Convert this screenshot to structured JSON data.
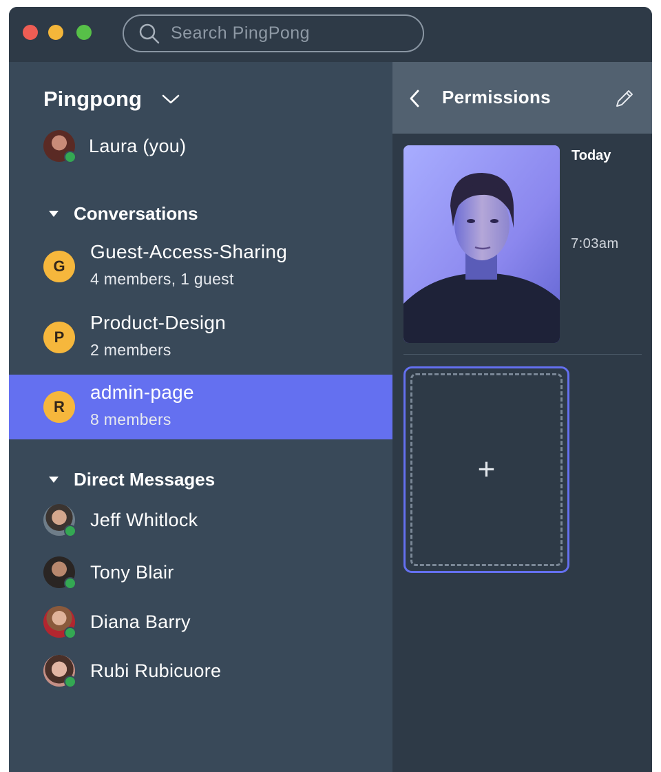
{
  "window": {
    "controls": [
      "close",
      "minimize",
      "zoom"
    ]
  },
  "search": {
    "placeholder": "Search PingPong",
    "icon": "search-icon"
  },
  "sidebar": {
    "team_name": "Pingpong",
    "current_user": {
      "name": "Laura (you)",
      "status": "online"
    },
    "conversations_header": "Conversations",
    "conversations": [
      {
        "letter": "G",
        "name": "Guest-Access-Sharing",
        "subtitle": "4 members, 1 guest",
        "active": false
      },
      {
        "letter": "P",
        "name": "Product-Design",
        "subtitle": "2 members",
        "active": false
      },
      {
        "letter": "R",
        "name": "admin-page",
        "subtitle": "8 members",
        "active": true
      }
    ],
    "dm_header": "Direct Messages",
    "direct_messages": [
      {
        "name": "Jeff Whitlock",
        "status": "online"
      },
      {
        "name": "Tony Blair",
        "status": "online"
      },
      {
        "name": "Diana Barry",
        "status": "online"
      },
      {
        "name": "Rubi Rubicuore",
        "status": "online"
      }
    ]
  },
  "panel": {
    "title": "Permissions",
    "date_label": "Today",
    "time_label": "7:03am",
    "upload_symbol": "+"
  },
  "colors": {
    "sidebar_bg": "#394959",
    "panel_bg": "#2e3a47",
    "accent": "#6470f0",
    "online": "#34a853",
    "letter_avatar": "#f6b73c"
  }
}
